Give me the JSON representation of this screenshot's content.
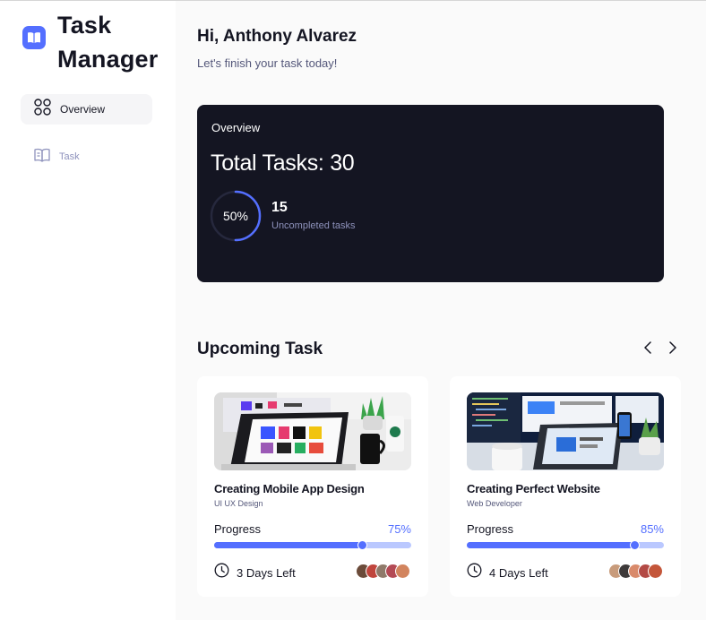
{
  "app": {
    "name_line1": "Task",
    "name_line2": "Manager",
    "accent": "#546fff",
    "dark": "#141522",
    "muted": "#8e92bc"
  },
  "sidebar": {
    "items": [
      {
        "label": "Overview",
        "icon": "grid-icon",
        "active": true
      },
      {
        "label": "Task",
        "icon": "book-icon",
        "active": false
      }
    ]
  },
  "header": {
    "greeting": "Hi, Anthony Alvarez",
    "subtitle": "Let's finish your task today!"
  },
  "overview": {
    "title": "Overview",
    "total_tasks": "Total Tasks: 30",
    "ring_percent": 50,
    "ring_label": "50%",
    "uncompleted_count": "15",
    "uncompleted_label": "Uncompleted tasks"
  },
  "upcoming": {
    "title": "Upcoming Task",
    "prev_icon": "chevron-left-icon",
    "next_icon": "chevron-right-icon",
    "tasks": [
      {
        "title": "Creating Mobile App Design",
        "role": "UI UX Design",
        "progress_label": "Progress",
        "progress_text": "75%",
        "progress": 0.75,
        "deadline": "3 Days Left",
        "image": "laptop-desk-photo"
      },
      {
        "title": "Creating Perfect Website",
        "role": "Web Developer",
        "progress_label": "Progress",
        "progress_text": "85%",
        "progress": 0.85,
        "deadline": "4 Days Left",
        "image": "monitor-desk-photo"
      }
    ]
  }
}
